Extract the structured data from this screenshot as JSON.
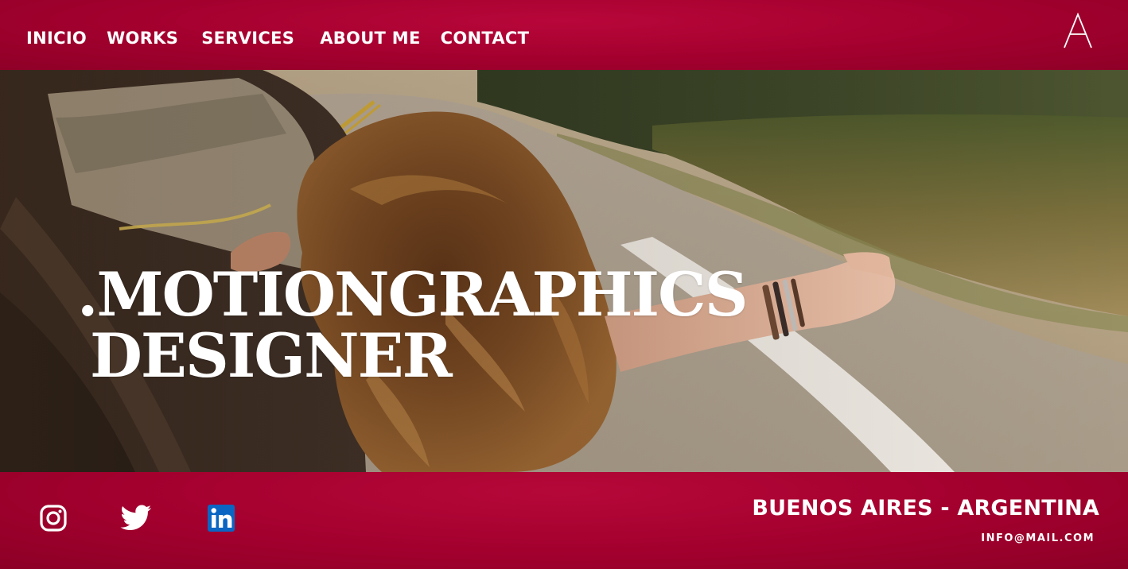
{
  "nav": {
    "items": [
      {
        "label": "INICIO"
      },
      {
        "label": "WORKS"
      },
      {
        "label": "SERVICES"
      },
      {
        "label": "ABOUT ME"
      },
      {
        "label": "CONTACT"
      }
    ]
  },
  "logo": {
    "icon": "letter-a-logo-icon"
  },
  "hero": {
    "image": "woman-leaning-out-car-window-photo",
    "headline_line1": ".MOTIONGRAPHICS",
    "headline_line2": "DESIGNER"
  },
  "footer": {
    "social": [
      {
        "icon": "instagram-icon"
      },
      {
        "icon": "twitter-icon"
      },
      {
        "icon": "linkedin-icon"
      }
    ],
    "location": "BUENOS AIRES - ARGENTINA",
    "email": "INFO@MAIL.COM"
  },
  "colors": {
    "brand": "#a8002f",
    "text": "#ffffff",
    "linkedin": "#0a66c2"
  }
}
